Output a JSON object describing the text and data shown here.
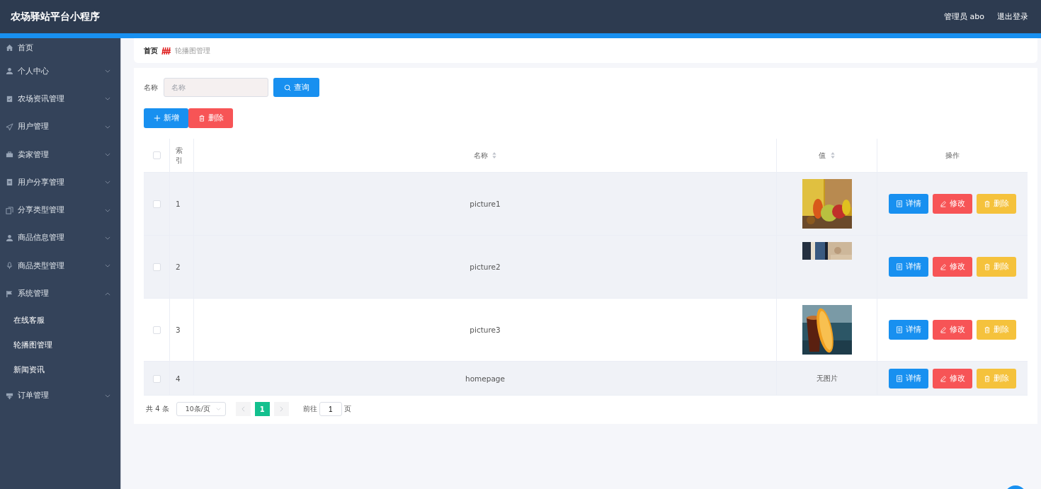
{
  "header": {
    "title": "农场驿站平台小程序",
    "user": "管理员 abo",
    "logout": "退出登录"
  },
  "sidebar": {
    "items": [
      {
        "label": "首页",
        "kind": "link"
      },
      {
        "label": "个人中心",
        "kind": "submenu",
        "expanded": false
      },
      {
        "label": "农场资讯管理",
        "kind": "submenu",
        "expanded": false
      },
      {
        "label": "用户管理",
        "kind": "submenu",
        "expanded": false
      },
      {
        "label": "卖家管理",
        "kind": "submenu",
        "expanded": false
      },
      {
        "label": "用户分享管理",
        "kind": "submenu",
        "expanded": false
      },
      {
        "label": "分享类型管理",
        "kind": "submenu",
        "expanded": false
      },
      {
        "label": "商品信息管理",
        "kind": "submenu",
        "expanded": false
      },
      {
        "label": "商品类型管理",
        "kind": "submenu",
        "expanded": false
      },
      {
        "label": "系统管理",
        "kind": "submenu",
        "expanded": true,
        "children": [
          {
            "label": "在线客服"
          },
          {
            "label": "轮播图管理"
          },
          {
            "label": "新闻资讯"
          }
        ]
      },
      {
        "label": "订单管理",
        "kind": "submenu",
        "expanded": false
      }
    ]
  },
  "breadcrumb": [
    {
      "label": "首页"
    },
    {
      "label": "轮播图管理"
    }
  ],
  "search": {
    "label": "名称",
    "placeholder": "名称",
    "button": "查询"
  },
  "actions": [
    {
      "label": "新增",
      "kind": "add"
    },
    {
      "label": "删除",
      "kind": "delete"
    }
  ],
  "table": {
    "select_all": {
      "checked": false
    },
    "columns": [
      {
        "kind": "checkbox"
      },
      {
        "label": "索引",
        "kind": "index"
      },
      {
        "label": "名称",
        "kind": "sortable"
      },
      {
        "label": "值",
        "kind": "sortable"
      },
      {
        "label": "操作",
        "kind": "plain"
      }
    ],
    "rows": [
      {
        "index": "1",
        "name": "picture1",
        "value": {
          "kind": "picture"
        },
        "highlighted": true,
        "checked": false,
        "buttons": [
          "详情",
          "修改",
          "删除"
        ]
      },
      {
        "index": "2",
        "name": "picture2",
        "value": {
          "kind": "picture"
        },
        "highlighted": true,
        "checked": false,
        "buttons": [
          "详情",
          "修改",
          "删除"
        ]
      },
      {
        "index": "3",
        "name": "picture3",
        "value": {
          "kind": "picture"
        },
        "highlighted": false,
        "checked": false,
        "buttons": [
          "详情",
          "修改",
          "删除"
        ]
      },
      {
        "index": "4",
        "name": "homepage",
        "value": {
          "kind": "text",
          "text": "无图片"
        },
        "highlighted": true,
        "checked": false,
        "buttons": [
          "详情",
          "修改",
          "删除"
        ]
      }
    ]
  },
  "pagination": {
    "total": "共 4 条",
    "page_size": "10条/页",
    "pages": [
      {
        "label": "1",
        "selected": true
      }
    ],
    "goto_label": "前往",
    "goto_value": "1",
    "goto_suffix": "页"
  }
}
